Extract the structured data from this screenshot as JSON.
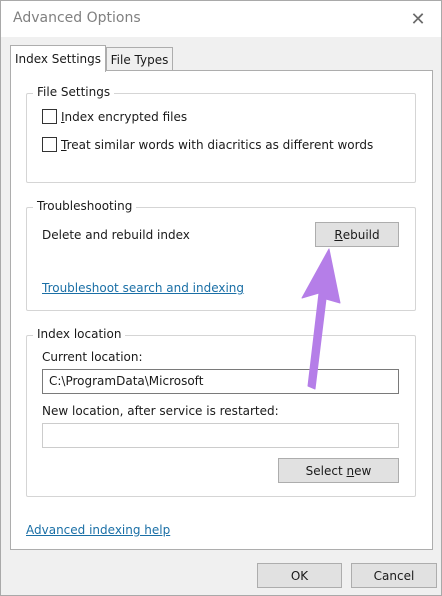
{
  "window": {
    "title": "Advanced Options",
    "close_glyph": "✕"
  },
  "tabs": [
    {
      "label": "Index Settings",
      "active": true
    },
    {
      "label": "File Types",
      "active": false
    }
  ],
  "file_settings": {
    "title": "File Settings",
    "options": [
      {
        "mnemonic": "I",
        "rest": "ndex encrypted files",
        "checked": false
      },
      {
        "mnemonic": "T",
        "rest": "reat similar words with diacritics as different words",
        "checked": false
      }
    ]
  },
  "troubleshooting": {
    "title": "Troubleshooting",
    "rebuild_label": "Delete and rebuild index",
    "rebuild_button": {
      "mnemonic": "R",
      "rest": "ebuild"
    },
    "link": "Troubleshoot search and indexing"
  },
  "index_location": {
    "title": "Index location",
    "current_label": "Current location:",
    "current_value": "C:\\ProgramData\\Microsoft",
    "new_label": "New location, after service is restarted:",
    "new_value": "",
    "select_button": {
      "before": "Select ",
      "mnemonic": "n",
      "after": "ew"
    }
  },
  "help_link": "Advanced indexing help",
  "footer": {
    "ok_label": "OK",
    "cancel_label": "Cancel"
  },
  "annotation": {
    "arrow_color": "#b57ee8"
  }
}
